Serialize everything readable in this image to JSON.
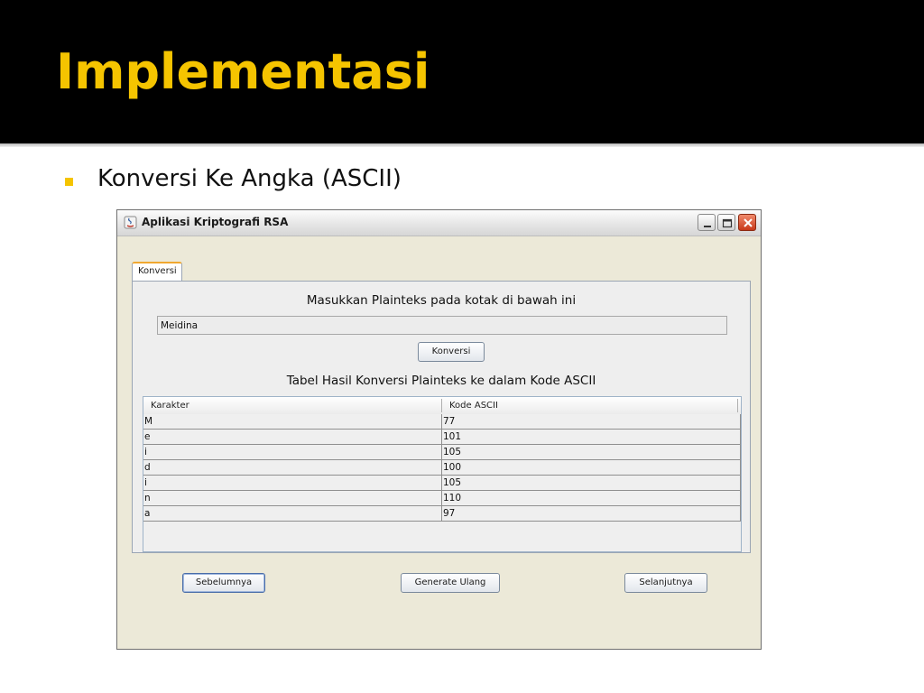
{
  "slide": {
    "title": "Implementasi",
    "bullet": "Konversi Ke Angka (ASCII)"
  },
  "window": {
    "title": "Aplikasi Kriptografi RSA",
    "controls": [
      "minimize-icon",
      "maximize-icon",
      "close-icon"
    ]
  },
  "tab": {
    "label": "Konversi"
  },
  "form": {
    "heading": "Masukkan Plainteks pada kotak di bawah ini",
    "input_value": "Meidina",
    "convert_button": "Konversi",
    "table_heading": "Tabel Hasil Konversi Plainteks ke dalam Kode ASCII"
  },
  "table": {
    "columns": [
      "Karakter",
      "Kode ASCII"
    ],
    "rows": [
      {
        "char": "M",
        "code": "77"
      },
      {
        "char": "e",
        "code": "101"
      },
      {
        "char": "i",
        "code": "105"
      },
      {
        "char": "d",
        "code": "100"
      },
      {
        "char": "i",
        "code": "105"
      },
      {
        "char": "n",
        "code": "110"
      },
      {
        "char": "a",
        "code": "97"
      }
    ]
  },
  "footer": {
    "prev_button": "Sebelumnya",
    "regenerate_button": "Generate Ulang",
    "next_button": "Selanjutnya"
  },
  "colors": {
    "title": "#f5c400",
    "bullet": "#f5c400",
    "tab_accent": "#f0a830"
  }
}
